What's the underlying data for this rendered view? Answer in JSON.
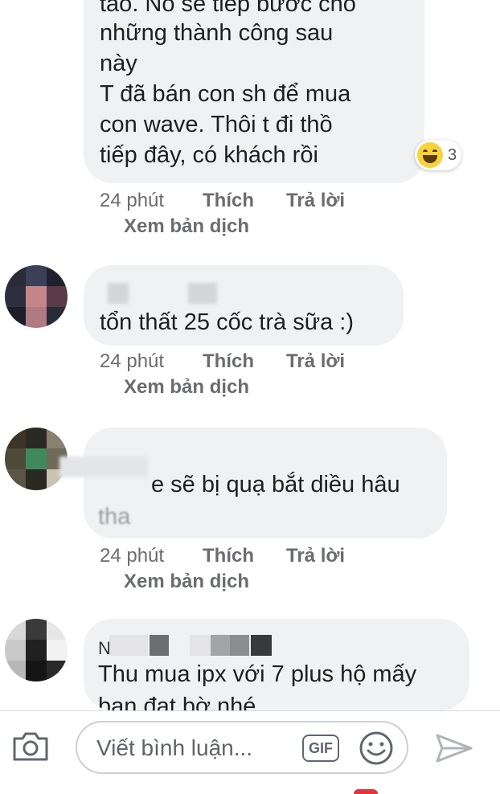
{
  "comments": [
    {
      "text_partial_top": "tao. Nó sẽ tiếp bước cho",
      "text": "những thành công sau\nnày\nT đã bán con sh để mua\ncon wave. Thôi t đi thồ\ntiếp đây, có khách rồi",
      "reaction_count": "3",
      "time": "24 phút",
      "like": "Thích",
      "reply": "Trả lời",
      "translate": "Xem bản dịch"
    },
    {
      "text": "tổn thất 25 cốc trà sữa :)",
      "time": "24 phút",
      "like": "Thích",
      "reply": "Trả lời",
      "translate": "Xem bản dịch"
    },
    {
      "text": "e sẽ bị quạ bắt diều hâu",
      "text2": "tha",
      "time": "24 phút",
      "like": "Thích",
      "reply": "Trả lời",
      "translate": "Xem bản dịch"
    },
    {
      "name_initial": "N",
      "text": "Thu mua ipx với 7 plus hộ mấy",
      "text_partial_bottom": "bạn đạt bờ nhé"
    }
  ],
  "composer": {
    "placeholder": "Viết bình luận...",
    "gif_label": "GIF"
  },
  "icons": {
    "camera": "camera-icon",
    "gif": "gif-icon",
    "emoji": "smile-icon",
    "send": "send-icon",
    "reaction": "laughing-face-icon"
  },
  "colors": {
    "bubble": "#f0f1f3",
    "meta_text": "#6a6c70",
    "reaction_yellow": "#f7d33b"
  }
}
